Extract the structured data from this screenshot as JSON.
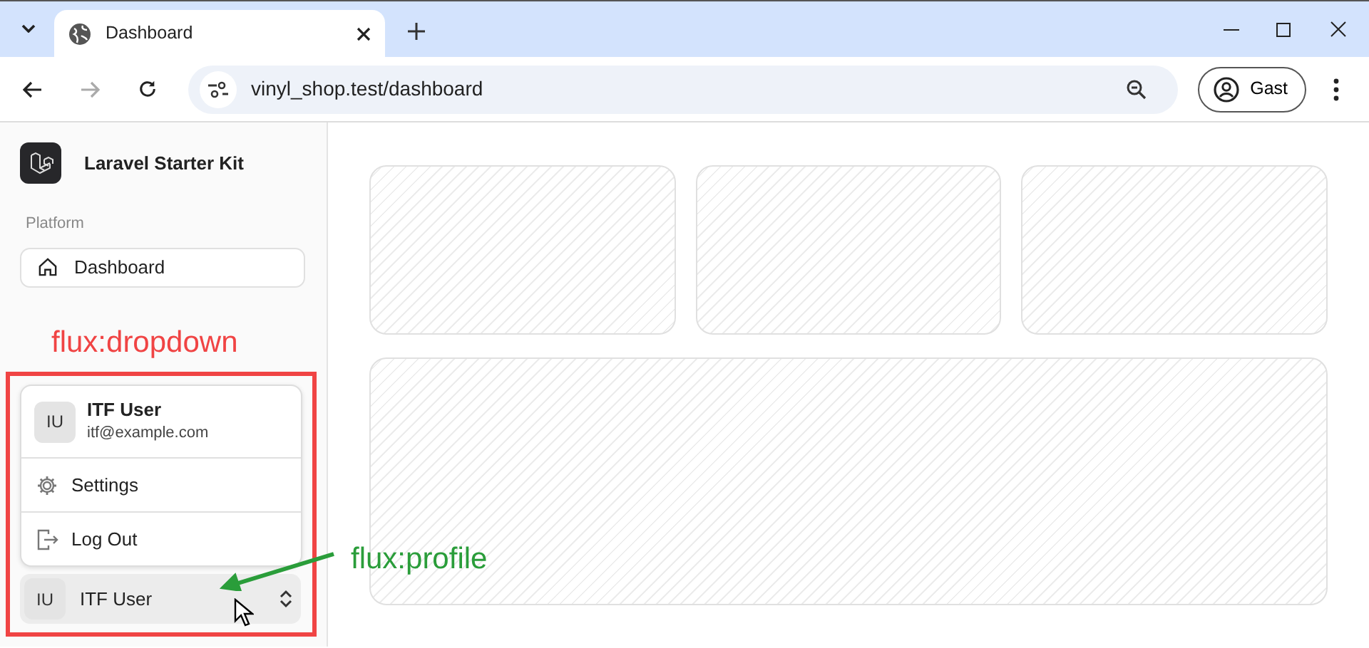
{
  "browser": {
    "tab_title": "Dashboard",
    "url": "vinyl_shop.test/dashboard",
    "profile_label": "Gast"
  },
  "sidebar": {
    "brand": "Laravel Starter Kit",
    "section": "Platform",
    "nav_items": [
      {
        "label": "Dashboard",
        "selected": true
      }
    ]
  },
  "dropdown": {
    "user": {
      "initials": "IU",
      "name": "ITF User",
      "email": "itf@example.com"
    },
    "items": [
      {
        "label": "Settings",
        "kind": "settings"
      },
      {
        "label": "Log Out",
        "kind": "logout"
      }
    ]
  },
  "profile": {
    "initials": "IU",
    "name": "ITF User"
  },
  "annotations": [
    {
      "text": "flux:dropdown",
      "kind": "frame",
      "color": "#f04444"
    },
    {
      "text": "flux:profile",
      "kind": "arrow",
      "color": "#2a9d3a"
    }
  ]
}
